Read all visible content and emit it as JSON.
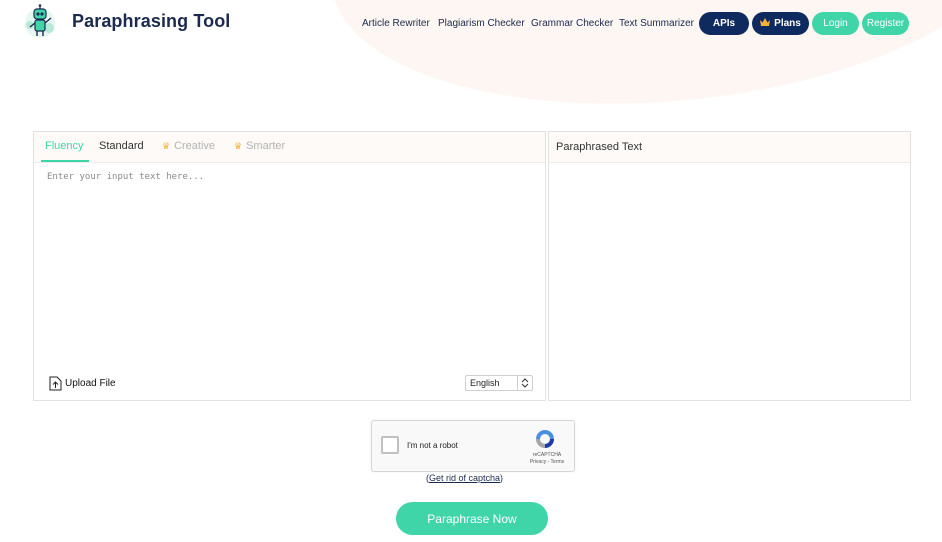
{
  "brand": {
    "name": "Paraphrasing Tool",
    "accent": "#3fd5a9",
    "navy": "#0f2a5e"
  },
  "nav": {
    "links": [
      "Article Rewriter",
      "Plagiarism Checker",
      "Grammar Checker",
      "Text Summarizer"
    ],
    "apis": "APIs",
    "plans": "Plans",
    "login": "Login",
    "register": "Register"
  },
  "editor": {
    "tabs": [
      {
        "label": "Fluency",
        "state": "active"
      },
      {
        "label": "Standard",
        "state": "normal"
      },
      {
        "label": "Creative",
        "state": "premium"
      },
      {
        "label": "Smarter",
        "state": "premium"
      }
    ],
    "placeholder": "Enter your input text here...",
    "upload_label": "Upload File",
    "language": "English",
    "output_title": "Paraphrased Text"
  },
  "captcha": {
    "label": "I'm not a robot",
    "brand": "reCAPTCHA",
    "terms": "Privacy - Terms",
    "link_text": "Get rid of captcha",
    "link_open": "(",
    "link_close": ")"
  },
  "submit_label": "Paraphrase Now"
}
